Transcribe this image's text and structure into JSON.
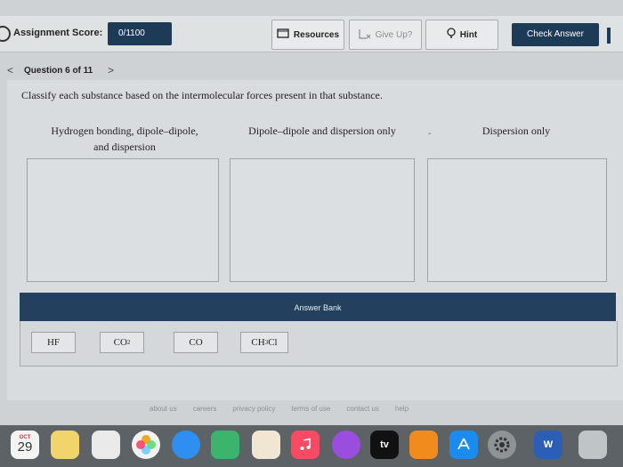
{
  "header": {
    "score_label": "Assignment Score:",
    "score_value": "0/1100",
    "resources_label": "Resources",
    "giveup_label": "Give Up?",
    "hint_label": "Hint",
    "check_label": "Check Answer"
  },
  "nav": {
    "back_glyph": "<",
    "title": "Question 6 of 11",
    "next_glyph": ">"
  },
  "question": {
    "prompt": "Classify each substance based on the intermolecular forces present in that substance.",
    "columns": [
      {
        "line1": "Hydrogen bonding, dipole–dipole,",
        "line2": "and dispersion"
      },
      {
        "line1": "Dipole–dipole and dispersion only",
        "line2": ""
      },
      {
        "line1": "Dispersion only",
        "line2": ""
      }
    ],
    "stray_mark": "-"
  },
  "answer_bank": {
    "title": "Answer Bank",
    "items": [
      "HF",
      "CO",
      "CO",
      "CH",
      "Cl"
    ],
    "subscripts": [
      "",
      "2",
      "",
      "3",
      ""
    ]
  },
  "footer": {
    "links": [
      "about us",
      "careers",
      "privacy policy",
      "terms of use",
      "contact us",
      "help"
    ]
  },
  "dock": {
    "calendar_month": "OCT",
    "calendar_day": "29",
    "tv_label": "tv",
    "word_label": "W"
  },
  "colors": {
    "navy": "#1d3a57",
    "bank_header": "#23405e",
    "background": "#cfd2d4"
  }
}
